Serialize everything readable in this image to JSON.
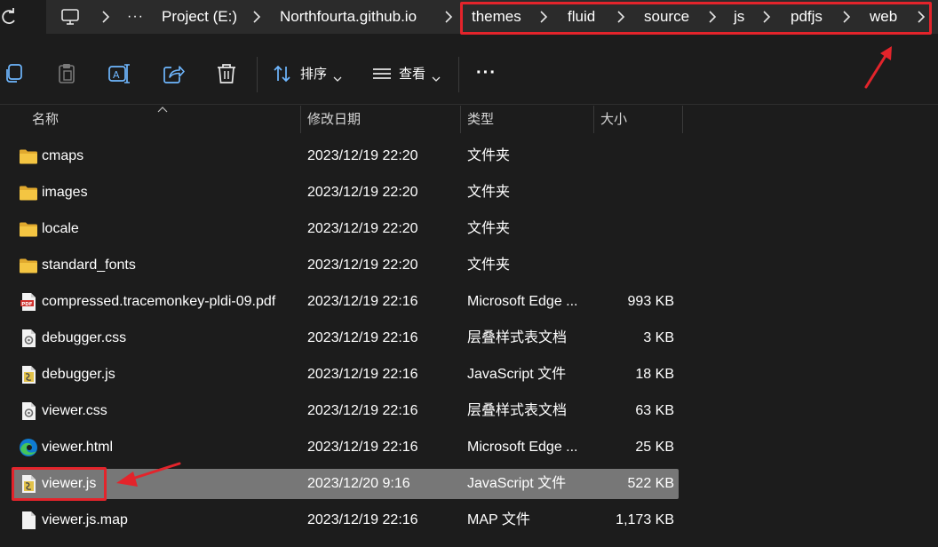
{
  "address_bar": {
    "refresh_icon": "refresh-icon",
    "computer_icon": "monitor-icon",
    "overflow": "···",
    "crumbs": [
      "Project (E:)",
      "Northfourta.github.io",
      "themes",
      "fluid",
      "source",
      "js",
      "pdfjs",
      "web"
    ],
    "chevron_icon": "chevron-right-icon"
  },
  "toolbar": {
    "copy_icon": "copy-icon",
    "paste_icon": "paste-icon",
    "rename_icon": "rename-icon",
    "share_icon": "share-icon",
    "delete_icon": "trash-icon",
    "sort_label": "排序",
    "sort_icon": "sort-icon",
    "view_label": "查看",
    "view_icon": "view-lines-icon",
    "more_label": "···"
  },
  "columns": {
    "name": "名称",
    "date": "修改日期",
    "type": "类型",
    "size": "大小"
  },
  "files": [
    {
      "name": "cmaps",
      "date": "2023/12/19 22:20",
      "type": "文件夹",
      "size": "",
      "icon": "folder-icon"
    },
    {
      "name": "images",
      "date": "2023/12/19 22:20",
      "type": "文件夹",
      "size": "",
      "icon": "folder-icon"
    },
    {
      "name": "locale",
      "date": "2023/12/19 22:20",
      "type": "文件夹",
      "size": "",
      "icon": "folder-icon"
    },
    {
      "name": "standard_fonts",
      "date": "2023/12/19 22:20",
      "type": "文件夹",
      "size": "",
      "icon": "folder-icon"
    },
    {
      "name": "compressed.tracemonkey-pldi-09.pdf",
      "date": "2023/12/19 22:16",
      "type": "Microsoft Edge ...",
      "size": "993 KB",
      "icon": "pdf-file-icon"
    },
    {
      "name": "debugger.css",
      "date": "2023/12/19 22:16",
      "type": "层叠样式表文档",
      "size": "3 KB",
      "icon": "css-file-icon"
    },
    {
      "name": "debugger.js",
      "date": "2023/12/19 22:16",
      "type": "JavaScript 文件",
      "size": "18 KB",
      "icon": "js-file-icon"
    },
    {
      "name": "viewer.css",
      "date": "2023/12/19 22:16",
      "type": "层叠样式表文档",
      "size": "63 KB",
      "icon": "css-file-icon"
    },
    {
      "name": "viewer.html",
      "date": "2023/12/19 22:16",
      "type": "Microsoft Edge ...",
      "size": "25 KB",
      "icon": "edge-file-icon"
    },
    {
      "name": "viewer.js",
      "date": "2023/12/20 9:16",
      "type": "JavaScript 文件",
      "size": "522 KB",
      "icon": "js-file-icon",
      "selected": true
    },
    {
      "name": "viewer.js.map",
      "date": "2023/12/19 22:16",
      "type": "MAP 文件",
      "size": "1,173 KB",
      "icon": "blank-file-icon"
    }
  ],
  "colors": {
    "background": "#1c1c1c",
    "address_bar": "#2b2b2b",
    "selected_row": "#777777",
    "annotation_red": "#e3242b",
    "folder_yellow": "#f4c542",
    "edge_blue": "#0f7bd1",
    "edge_green": "#45c45a"
  }
}
